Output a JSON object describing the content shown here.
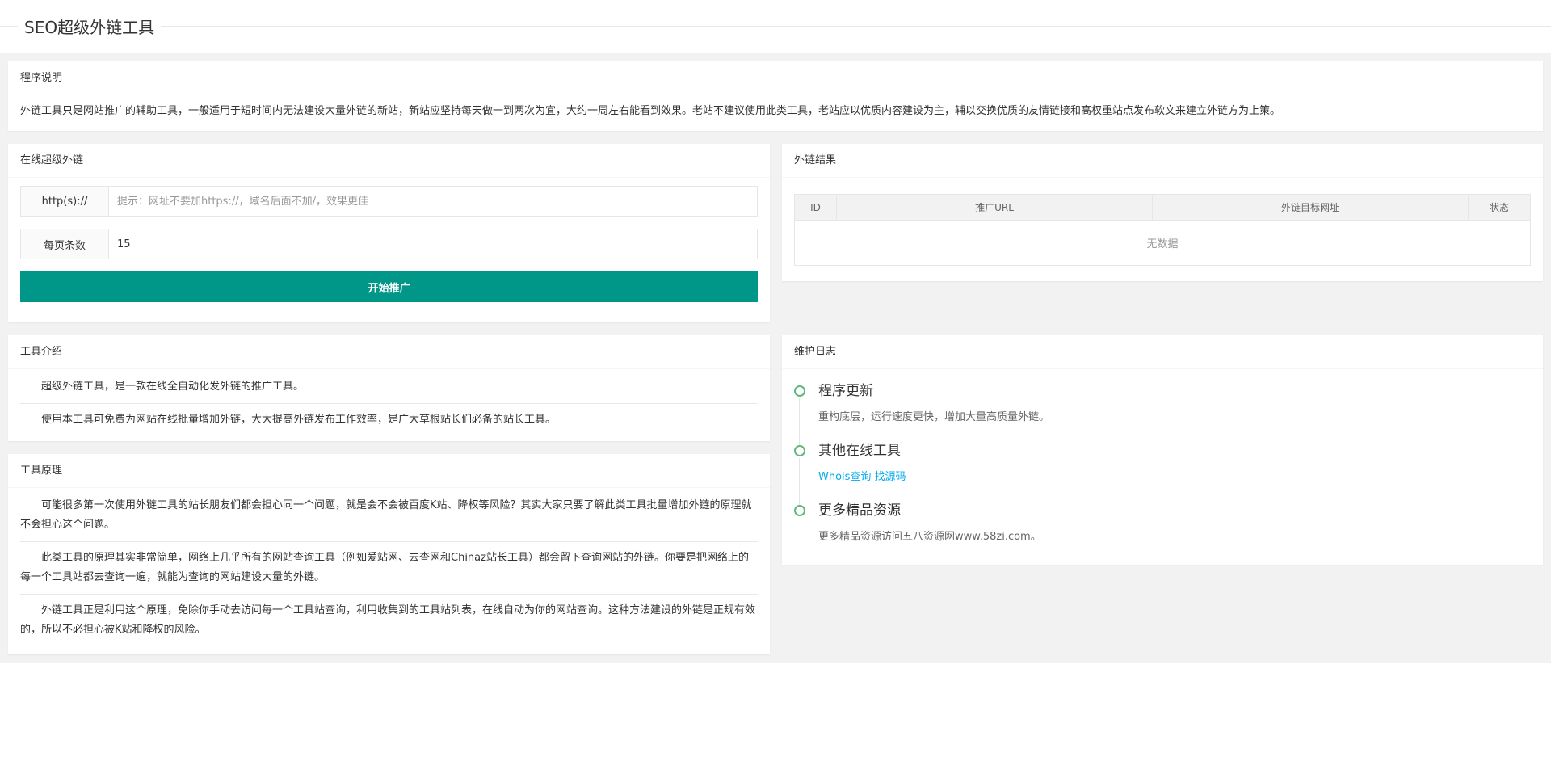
{
  "page": {
    "title": "SEO超级外链工具"
  },
  "description": {
    "header": "程序说明",
    "text": "外链工具只是网站推广的辅助工具，一般适用于短时间内无法建设大量外链的新站，新站应坚持每天做一到两次为宜，大约一周左右能看到效果。老站不建议使用此类工具，老站应以优质内容建设为主，辅以交换优质的友情链接和高权重站点发布软文来建立外链方为上策。"
  },
  "form": {
    "header": "在线超级外链",
    "url_label": "http(s)://",
    "url_placeholder": "提示：网址不要加https://，域名后面不加/，效果更佳",
    "url_value": "",
    "per_page_label": "每页条数",
    "per_page_value": "15",
    "submit_label": "开始推广"
  },
  "result": {
    "header": "外链结果",
    "columns": [
      "ID",
      "推广URL",
      "外链目标网址",
      "状态"
    ],
    "empty_text": "无数据"
  },
  "intro": {
    "header": "工具介绍",
    "paragraphs": [
      "超级外链工具，是一款在线全自动化发外链的推广工具。",
      "使用本工具可免费为网站在线批量增加外链，大大提高外链发布工作效率，是广大草根站长们必备的站长工具。"
    ]
  },
  "principle": {
    "header": "工具原理",
    "paragraphs": [
      "可能很多第一次使用外链工具的站长朋友们都会担心同一个问题，就是会不会被百度K站、降权等风险？其实大家只要了解此类工具批量增加外链的原理就不会担心这个问题。",
      "此类工具的原理其实非常简单，网络上几乎所有的网站查询工具（例如爱站网、去查网和Chinaz站长工具）都会留下查询网站的外链。你要是把网络上的每一个工具站都去查询一遍，就能为查询的网站建设大量的外链。",
      "外链工具正是利用这个原理，免除你手动去访问每一个工具站查询，利用收集到的工具站列表，在线自动为你的网站查询。这种方法建设的外链是正规有效的，所以不必担心被K站和降权的风险。"
    ]
  },
  "log": {
    "header": "维护日志",
    "items": [
      {
        "title": "程序更新",
        "text": "重构底层，运行速度更快，增加大量高质量外链。"
      },
      {
        "title": "其他在线工具",
        "links": [
          "Whois查询",
          "找源码"
        ]
      },
      {
        "title": "更多精品资源",
        "text": "更多精品资源访问五八资源网www.58zi.com。"
      }
    ]
  },
  "colors": {
    "primary": "#009688",
    "link": "#01aaed",
    "timeline_dot": "#5fb878"
  }
}
